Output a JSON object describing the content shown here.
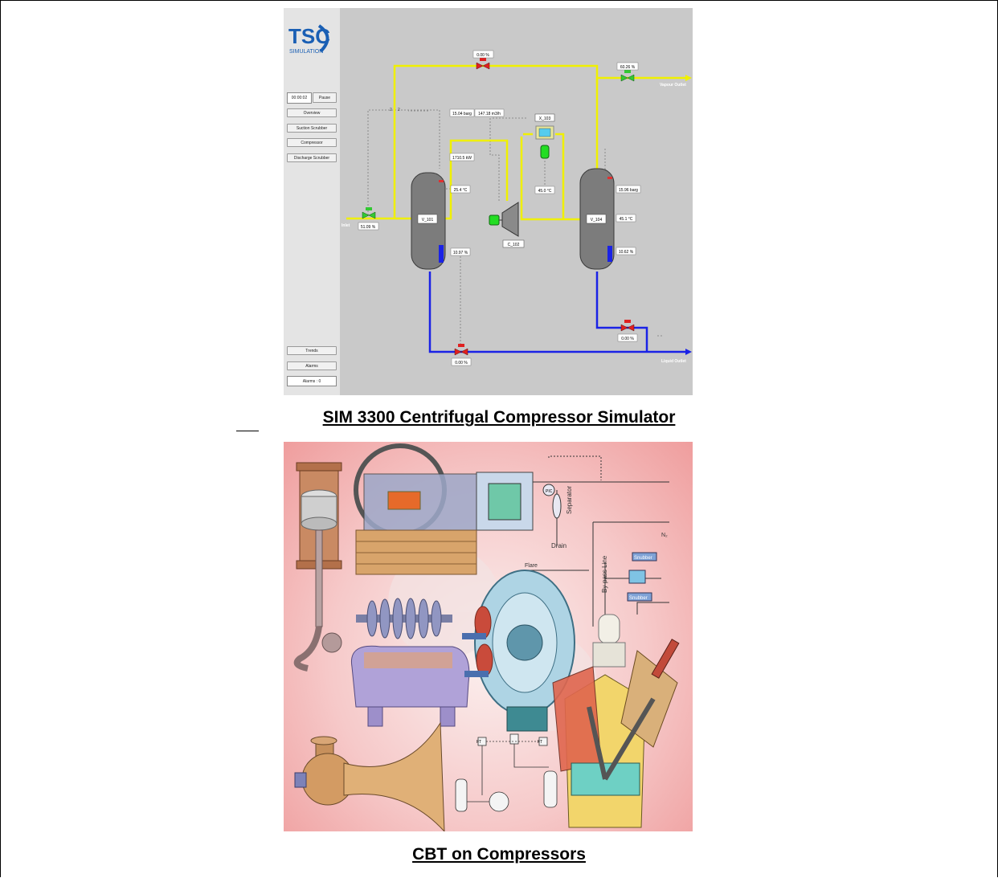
{
  "simulator": {
    "logo_text": "TSC",
    "logo_subtext": "SIMULATION",
    "timer": "00:00:02",
    "pause_label": "Pause",
    "nav": [
      "Overview",
      "Suction Scrubber",
      "Compressor",
      "Discharge Scrubber"
    ],
    "trends_label": "Trends",
    "alarms_label": "Alarms",
    "alarm_count": "Alarms : 0",
    "labels": {
      "inlet": "Inlet",
      "vapour_outlet": "Vapour Outlet",
      "liquid_outlet": "Liquid Outlet",
      "v101": "V_101",
      "v104": "V_104",
      "c102": "C_102",
      "x103": "X_103"
    },
    "readouts": {
      "inlet_valve": "51.09 %",
      "top_valve": "0.00 %",
      "vapour_valve": "60.26 %",
      "pressure_suction": "15.04 barg",
      "flow_suction": "147.18 m3/h",
      "power": "1710.5 kW",
      "v101_temp": "25.4 °C",
      "v101_level": "10.97 %",
      "x103_temp": "45.0 °C",
      "v104_pressure": "15.96 barg",
      "v104_temp": "45.1 °C",
      "v104_level": "10.62 %",
      "liquid_valve_right": "0.00 %",
      "liquid_valve_bottom": "0.00 %",
      "tag_a": "2",
      "tag_b": "2"
    },
    "colors": {
      "vapour": "#f0f000",
      "liquid": "#1a22e6",
      "valve_open": "#33c833",
      "valve_closed": "#e02020"
    }
  },
  "captions": {
    "simulator": "SIM 3300 Centrifugal Compressor Simulator",
    "cbt": "CBT on Compressors"
  },
  "cbt_labels": {
    "separator": "Separator",
    "drain": "Drain",
    "bypass": "By-pass Line",
    "snubber_top": "Snubber",
    "snubber_bottom": "Snubber",
    "flare": "Flare",
    "nitrogen": "N₂",
    "pic": "PIC",
    "ft_left": "FT",
    "ft_right": "FT"
  }
}
